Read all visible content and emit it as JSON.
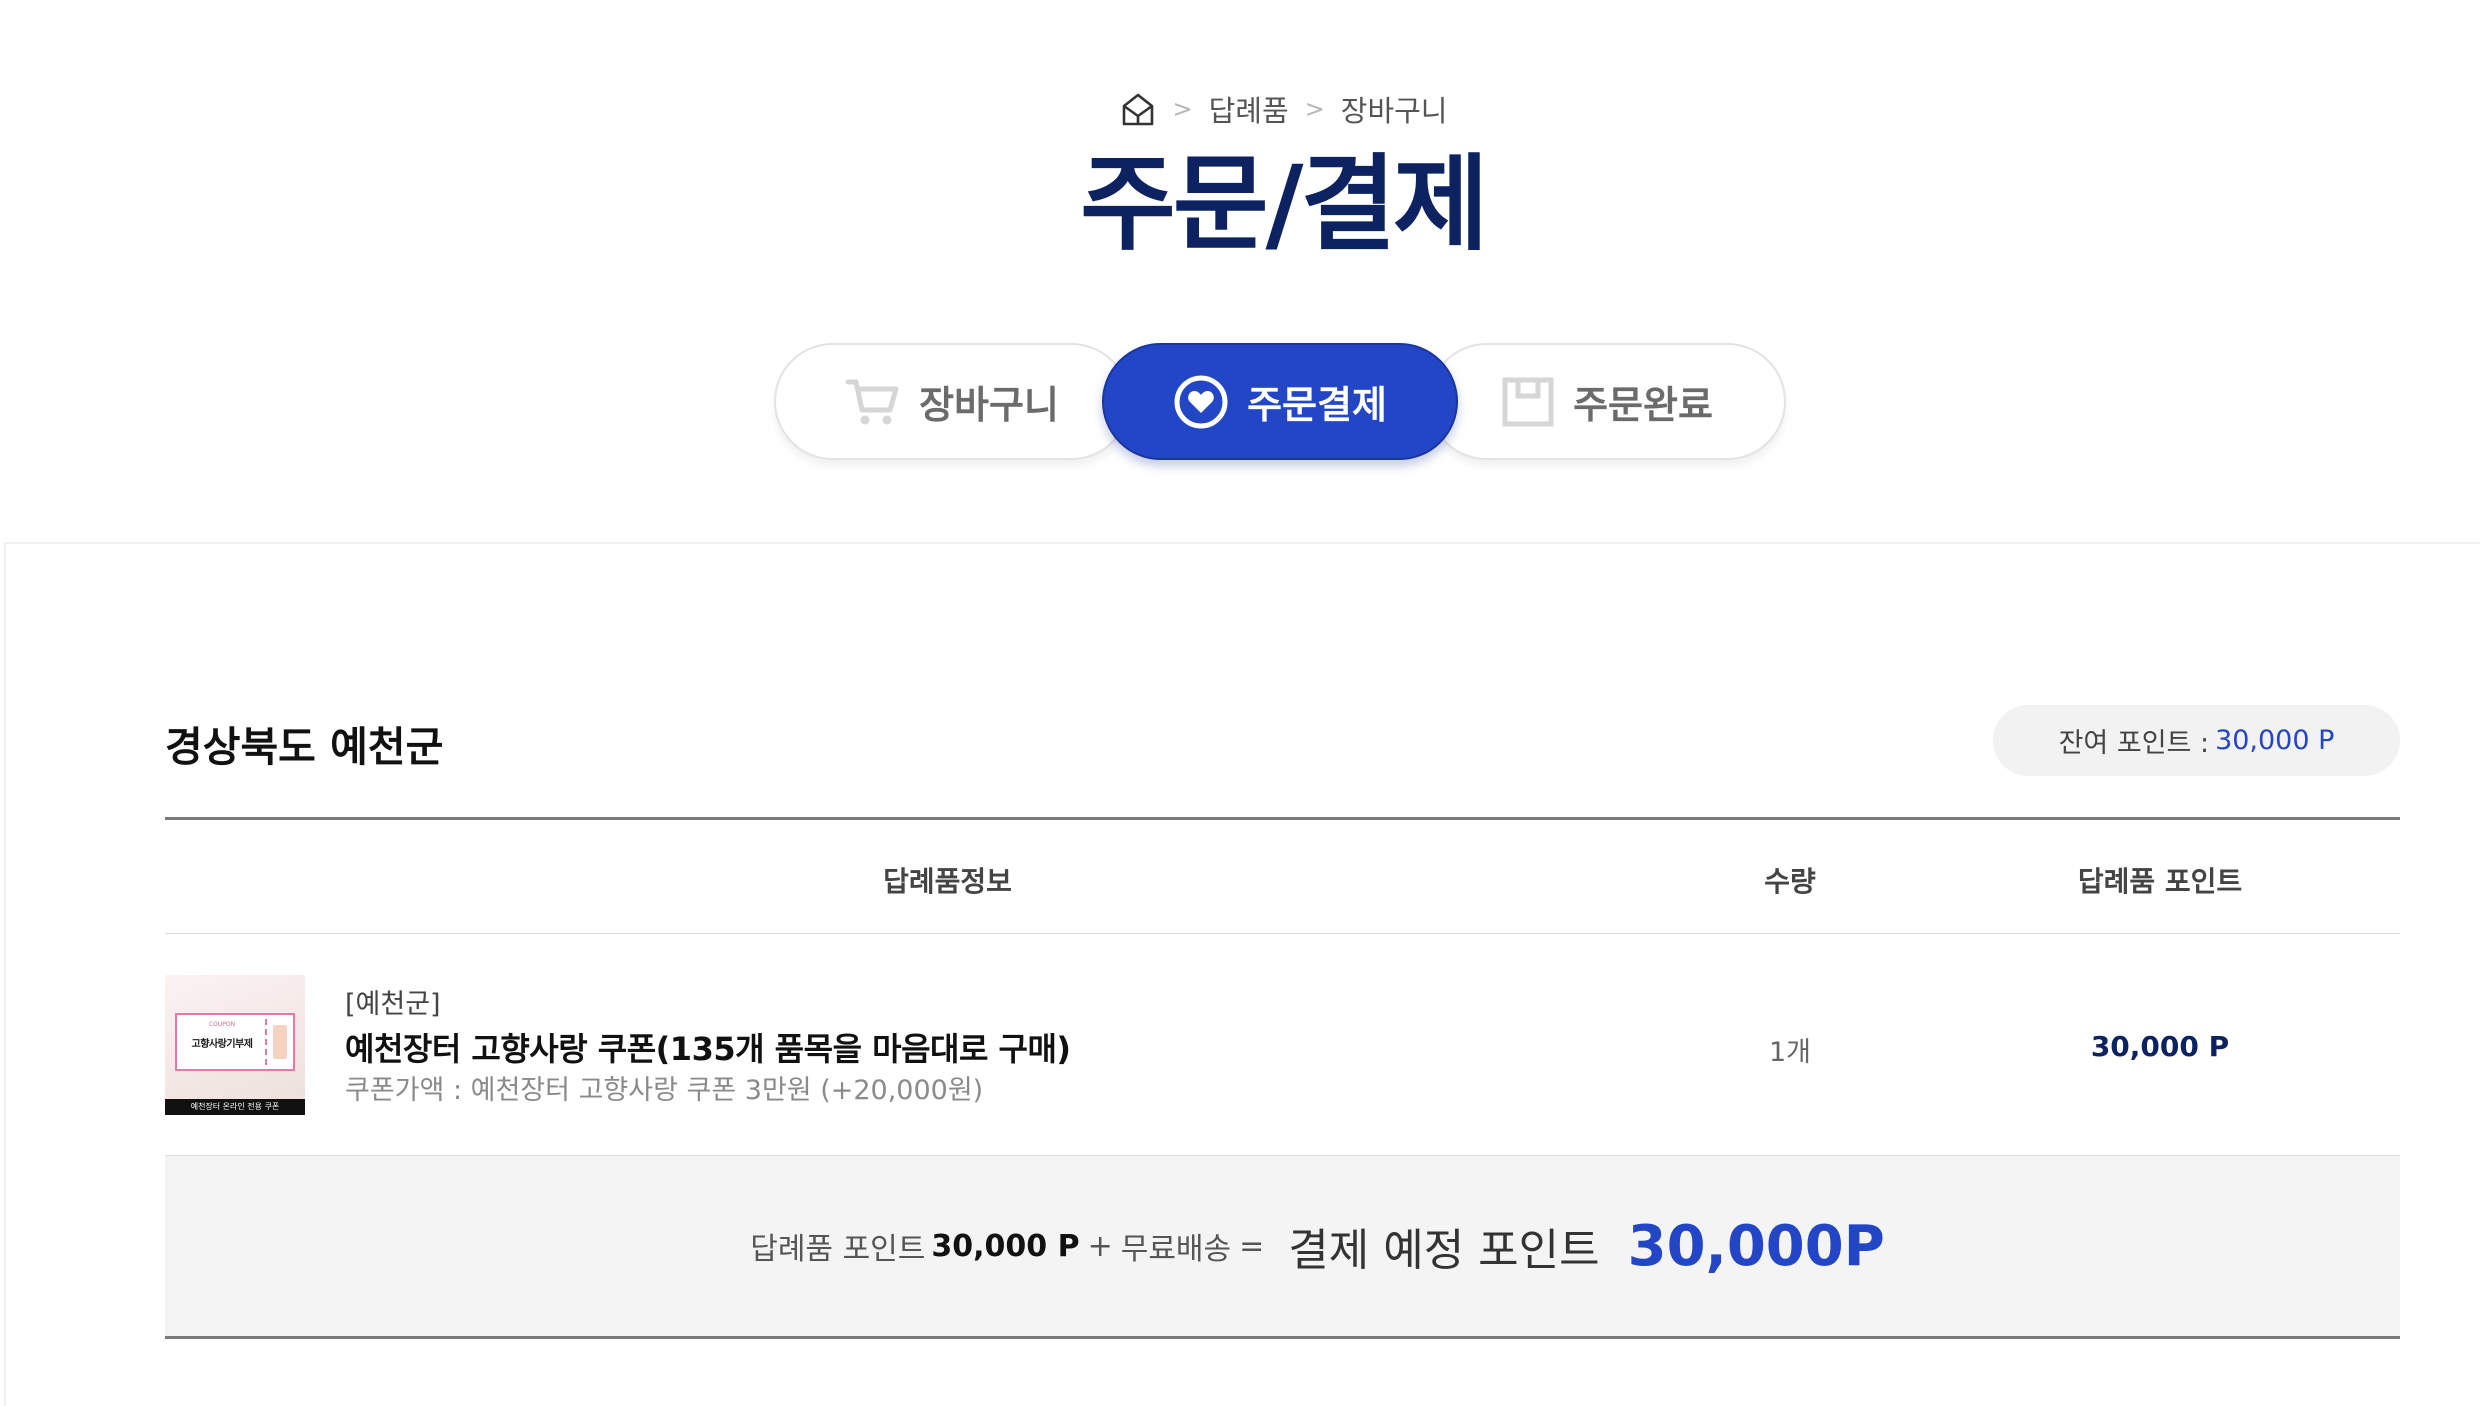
{
  "breadcrumb": {
    "items": [
      "답례품",
      "장바구니"
    ]
  },
  "page_title": "주문/결제",
  "steps": [
    {
      "label": "장바구니",
      "icon": "cart-icon",
      "active": false
    },
    {
      "label": "주문결제",
      "icon": "heart-circle-icon",
      "active": true
    },
    {
      "label": "주문완료",
      "icon": "box-icon",
      "active": false
    }
  ],
  "order": {
    "region_title": "경상북도 예천군",
    "points_label": "잔여 포인트 :",
    "points_value": "30,000 P",
    "table": {
      "headers": {
        "info": "답례품정보",
        "qty": "수량",
        "points": "답례품 포인트"
      },
      "rows": [
        {
          "region": "[예천군]",
          "name": "예천장터 고향사랑 쿠폰(135개 품목을 마음대로 구매)",
          "option": "쿠폰가액 : 예천장터 고향사랑 쿠폰 3만원 (+20,000원)",
          "qty": "1개",
          "points": "30,000 P",
          "thumb": {
            "coupon_label": "COUPON",
            "title": "고향사랑기부제",
            "band": "예천장터 온라인 전용 쿠폰"
          }
        }
      ]
    },
    "summary": {
      "goods_label": "답례품 포인트",
      "goods_value": "30,000 P",
      "plus": "+",
      "shipping": "무료배송",
      "equals": "=",
      "total_label": "결제 예정 포인트",
      "total_value": "30,000P"
    }
  },
  "colors": {
    "primary": "#2346c6",
    "title_navy": "#0d2260",
    "summary_bg": "#f4f4f4"
  }
}
